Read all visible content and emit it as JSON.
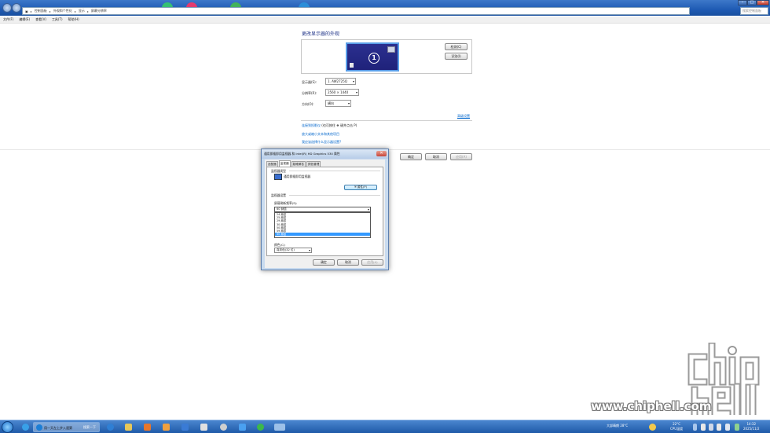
{
  "address": {
    "crumbs": [
      "控制面板",
      "外观和个性化",
      "显示",
      "屏幕分辨率"
    ],
    "search_placeholder": "搜索控制面板"
  },
  "menu": [
    "文件(F)",
    "编辑(E)",
    "查看(V)",
    "工具(T)",
    "帮助(H)"
  ],
  "main": {
    "title": "更改显示器的外观",
    "monitor_number": "1",
    "detect_label": "检测(C)",
    "identify_label": "识别(I)",
    "display_label": "显示器(S):",
    "display_value": "1. AW2725Q",
    "resolution_label": "分辨率(R):",
    "resolution_value": "2560 × 1440",
    "orientation_label": "方向(O):",
    "orientation_value": "横向",
    "advanced_link": "高级设置",
    "link1": "连接到投影仪",
    "link1_suffix": "(也可按住",
    "link1_suffix2": "键并点击 P)",
    "link2": "放大或缩小文本和其他项目",
    "link3": "我应该选择什么显示器设置?",
    "ok_label": "确定",
    "cancel_label": "取消",
    "apply_label": "应用(A)"
  },
  "dialog": {
    "title": "通用即插即用监视器 和 Intel(R) HD Graphics 530 属性",
    "tabs": [
      "适配器",
      "监视器",
      "疑难解答",
      "颜色管理"
    ],
    "active_tab": 1,
    "monitor_type_label": "监视器类型",
    "monitor_type_value": "通用即插即用监视器",
    "properties_label": "属性(P)",
    "monitor_settings_label": "监视器设置",
    "refresh_label": "屏幕刷新频率(S):",
    "refresh_value": "60 赫兹",
    "refresh_options": [
      "24 赫兹",
      "25 赫兹",
      "29 赫兹",
      "30 赫兹",
      "50 赫兹",
      "59 赫兹",
      "60 赫兹"
    ],
    "refresh_selected": 6,
    "color_label": "颜色(C):",
    "color_value": "真彩色(32 位)",
    "ok_label": "确定",
    "cancel_label": "取消",
    "apply_label": "应用(A)"
  },
  "watermark": {
    "text": "www.chiphell.com"
  },
  "taskbar": {
    "task_label": "用一天左上步入速第",
    "task2_label": "搜索一下",
    "weather": "大部晴朗 28°C",
    "cpu_temp": "22°C",
    "cpu_label": "CPU温度",
    "time": "14:32",
    "date": "2025/11/2"
  }
}
